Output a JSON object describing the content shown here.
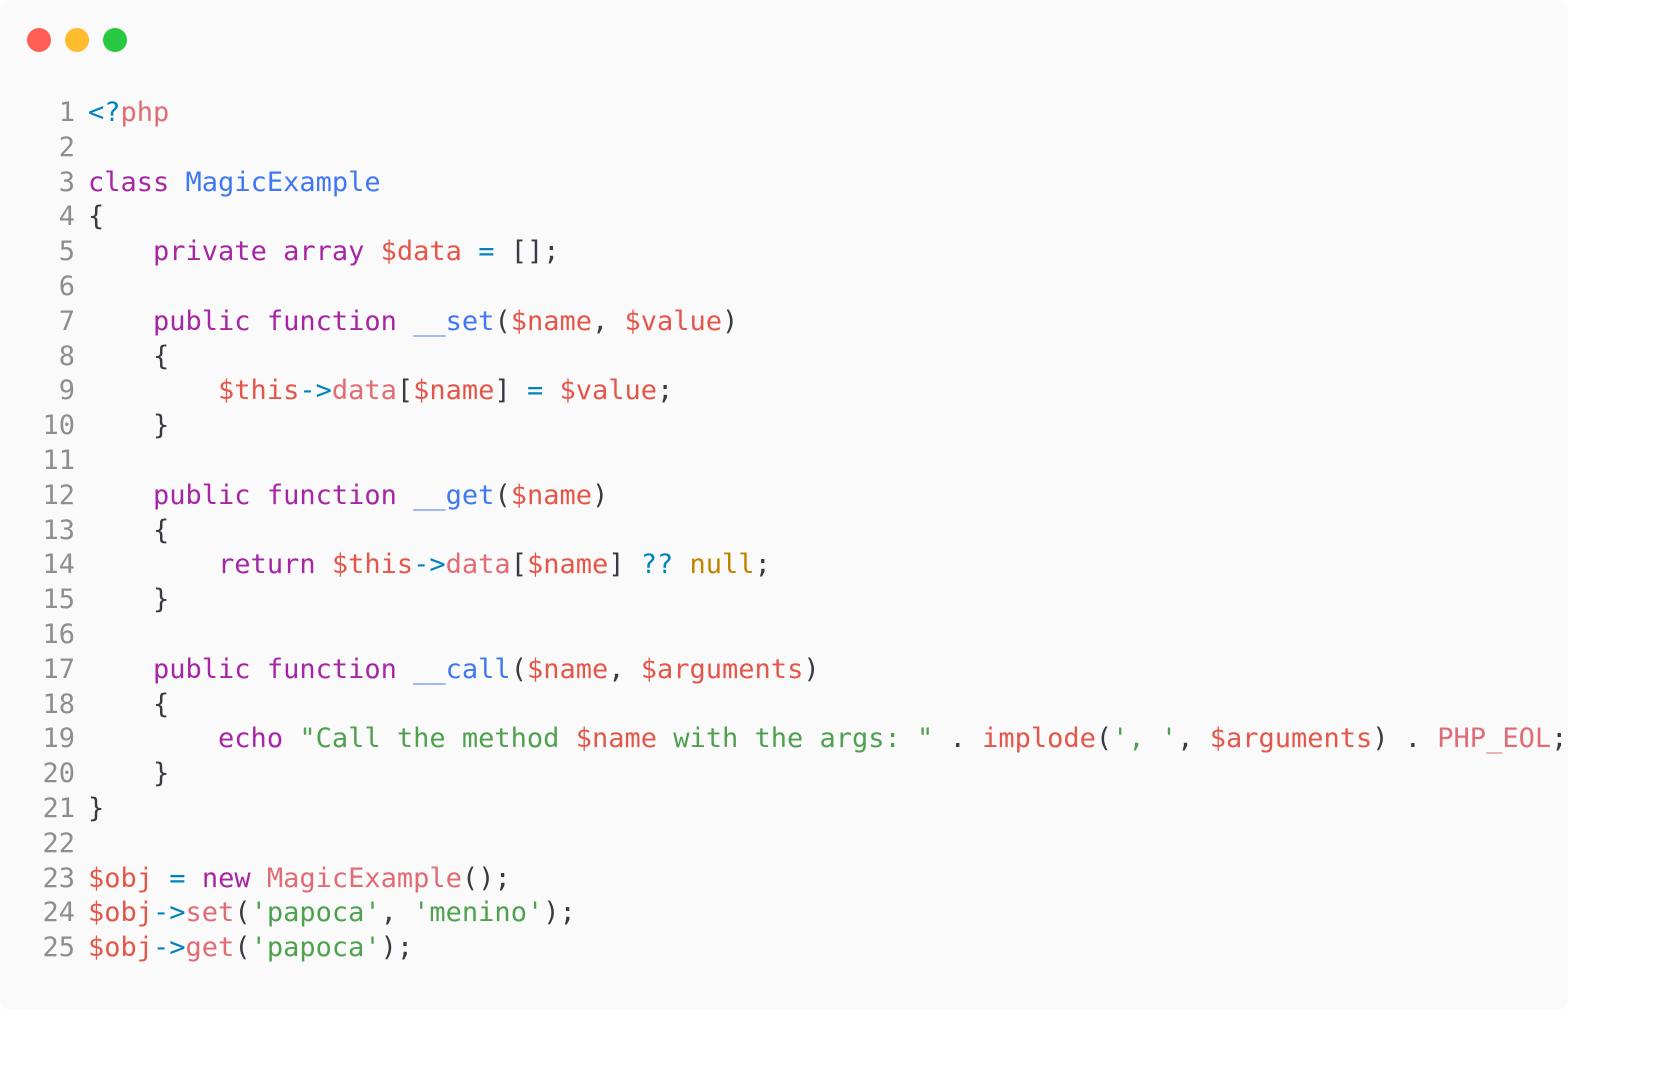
{
  "window": {
    "controls": [
      {
        "name": "close-button",
        "color": "#ff5f57"
      },
      {
        "name": "minimize-button",
        "color": "#febc2e"
      },
      {
        "name": "maximize-button",
        "color": "#28c840"
      }
    ]
  },
  "editor": {
    "language": "php",
    "palette": {
      "plain": "#383a42",
      "keyword": "#a626a4",
      "function": "#4078f2",
      "variable": "#e45649",
      "string": "#50a14f",
      "operator": "#0184bc",
      "constant": "#c18401",
      "tag": "#e06c75",
      "line_number": "#8e8e8e"
    },
    "lines": [
      {
        "n": "1",
        "tokens": [
          {
            "t": "<?",
            "k": "operator"
          },
          {
            "t": "php",
            "k": "tag"
          }
        ]
      },
      {
        "n": "2",
        "tokens": []
      },
      {
        "n": "3",
        "tokens": [
          {
            "t": "class",
            "k": "keyword"
          },
          {
            "t": " ",
            "k": "plain"
          },
          {
            "t": "MagicExample",
            "k": "function"
          }
        ]
      },
      {
        "n": "4",
        "tokens": [
          {
            "t": "{",
            "k": "plain"
          }
        ]
      },
      {
        "n": "5",
        "tokens": [
          {
            "t": "    ",
            "k": "plain"
          },
          {
            "t": "private",
            "k": "keyword"
          },
          {
            "t": " ",
            "k": "plain"
          },
          {
            "t": "array",
            "k": "keyword"
          },
          {
            "t": " ",
            "k": "plain"
          },
          {
            "t": "$data",
            "k": "variable"
          },
          {
            "t": " ",
            "k": "plain"
          },
          {
            "t": "=",
            "k": "operator"
          },
          {
            "t": " [];",
            "k": "plain"
          }
        ]
      },
      {
        "n": "6",
        "tokens": []
      },
      {
        "n": "7",
        "tokens": [
          {
            "t": "    ",
            "k": "plain"
          },
          {
            "t": "public",
            "k": "keyword"
          },
          {
            "t": " ",
            "k": "plain"
          },
          {
            "t": "function",
            "k": "keyword"
          },
          {
            "t": " ",
            "k": "plain"
          },
          {
            "t": "__set",
            "k": "function"
          },
          {
            "t": "(",
            "k": "plain"
          },
          {
            "t": "$name",
            "k": "variable"
          },
          {
            "t": ", ",
            "k": "plain"
          },
          {
            "t": "$value",
            "k": "variable"
          },
          {
            "t": ")",
            "k": "plain"
          }
        ]
      },
      {
        "n": "8",
        "tokens": [
          {
            "t": "    {",
            "k": "plain"
          }
        ]
      },
      {
        "n": "9",
        "tokens": [
          {
            "t": "        ",
            "k": "plain"
          },
          {
            "t": "$this",
            "k": "variable"
          },
          {
            "t": "->",
            "k": "operator"
          },
          {
            "t": "data",
            "k": "tag"
          },
          {
            "t": "[",
            "k": "plain"
          },
          {
            "t": "$name",
            "k": "variable"
          },
          {
            "t": "] ",
            "k": "plain"
          },
          {
            "t": "=",
            "k": "operator"
          },
          {
            "t": " ",
            "k": "plain"
          },
          {
            "t": "$value",
            "k": "variable"
          },
          {
            "t": ";",
            "k": "plain"
          }
        ]
      },
      {
        "n": "10",
        "tokens": [
          {
            "t": "    }",
            "k": "plain"
          }
        ]
      },
      {
        "n": "11",
        "tokens": []
      },
      {
        "n": "12",
        "tokens": [
          {
            "t": "    ",
            "k": "plain"
          },
          {
            "t": "public",
            "k": "keyword"
          },
          {
            "t": " ",
            "k": "plain"
          },
          {
            "t": "function",
            "k": "keyword"
          },
          {
            "t": " ",
            "k": "plain"
          },
          {
            "t": "__get",
            "k": "function"
          },
          {
            "t": "(",
            "k": "plain"
          },
          {
            "t": "$name",
            "k": "variable"
          },
          {
            "t": ")",
            "k": "plain"
          }
        ]
      },
      {
        "n": "13",
        "tokens": [
          {
            "t": "    {",
            "k": "plain"
          }
        ]
      },
      {
        "n": "14",
        "tokens": [
          {
            "t": "        ",
            "k": "plain"
          },
          {
            "t": "return",
            "k": "keyword"
          },
          {
            "t": " ",
            "k": "plain"
          },
          {
            "t": "$this",
            "k": "variable"
          },
          {
            "t": "->",
            "k": "operator"
          },
          {
            "t": "data",
            "k": "tag"
          },
          {
            "t": "[",
            "k": "plain"
          },
          {
            "t": "$name",
            "k": "variable"
          },
          {
            "t": "] ",
            "k": "plain"
          },
          {
            "t": "??",
            "k": "operator"
          },
          {
            "t": " ",
            "k": "plain"
          },
          {
            "t": "null",
            "k": "constant"
          },
          {
            "t": ";",
            "k": "plain"
          }
        ]
      },
      {
        "n": "15",
        "tokens": [
          {
            "t": "    }",
            "k": "plain"
          }
        ]
      },
      {
        "n": "16",
        "tokens": []
      },
      {
        "n": "17",
        "tokens": [
          {
            "t": "    ",
            "k": "plain"
          },
          {
            "t": "public",
            "k": "keyword"
          },
          {
            "t": " ",
            "k": "plain"
          },
          {
            "t": "function",
            "k": "keyword"
          },
          {
            "t": " ",
            "k": "plain"
          },
          {
            "t": "__call",
            "k": "function"
          },
          {
            "t": "(",
            "k": "plain"
          },
          {
            "t": "$name",
            "k": "variable"
          },
          {
            "t": ", ",
            "k": "plain"
          },
          {
            "t": "$arguments",
            "k": "variable"
          },
          {
            "t": ")",
            "k": "plain"
          }
        ]
      },
      {
        "n": "18",
        "tokens": [
          {
            "t": "    {",
            "k": "plain"
          }
        ]
      },
      {
        "n": "19",
        "tokens": [
          {
            "t": "        ",
            "k": "plain"
          },
          {
            "t": "echo",
            "k": "keyword"
          },
          {
            "t": " ",
            "k": "plain"
          },
          {
            "t": "\"Call the method ",
            "k": "string"
          },
          {
            "t": "$name",
            "k": "variable"
          },
          {
            "t": " with the args: \"",
            "k": "string"
          },
          {
            "t": " . ",
            "k": "plain"
          },
          {
            "t": "implode",
            "k": "variable"
          },
          {
            "t": "(",
            "k": "plain"
          },
          {
            "t": "', '",
            "k": "string"
          },
          {
            "t": ", ",
            "k": "plain"
          },
          {
            "t": "$arguments",
            "k": "variable"
          },
          {
            "t": ") . ",
            "k": "plain"
          },
          {
            "t": "PHP_EOL",
            "k": "tag"
          },
          {
            "t": ";",
            "k": "plain"
          }
        ]
      },
      {
        "n": "20",
        "tokens": [
          {
            "t": "    }",
            "k": "plain"
          }
        ]
      },
      {
        "n": "21",
        "tokens": [
          {
            "t": "}",
            "k": "plain"
          }
        ]
      },
      {
        "n": "22",
        "tokens": []
      },
      {
        "n": "23",
        "tokens": [
          {
            "t": "$obj",
            "k": "variable"
          },
          {
            "t": " ",
            "k": "plain"
          },
          {
            "t": "=",
            "k": "operator"
          },
          {
            "t": " ",
            "k": "plain"
          },
          {
            "t": "new",
            "k": "keyword"
          },
          {
            "t": " ",
            "k": "plain"
          },
          {
            "t": "MagicExample",
            "k": "tag"
          },
          {
            "t": "();",
            "k": "plain"
          }
        ]
      },
      {
        "n": "24",
        "tokens": [
          {
            "t": "$obj",
            "k": "variable"
          },
          {
            "t": "->",
            "k": "operator"
          },
          {
            "t": "set",
            "k": "tag"
          },
          {
            "t": "(",
            "k": "plain"
          },
          {
            "t": "'papoca'",
            "k": "string"
          },
          {
            "t": ", ",
            "k": "plain"
          },
          {
            "t": "'menino'",
            "k": "string"
          },
          {
            "t": ");",
            "k": "plain"
          }
        ]
      },
      {
        "n": "25",
        "tokens": [
          {
            "t": "$obj",
            "k": "variable"
          },
          {
            "t": "->",
            "k": "operator"
          },
          {
            "t": "get",
            "k": "tag"
          },
          {
            "t": "(",
            "k": "plain"
          },
          {
            "t": "'papoca'",
            "k": "string"
          },
          {
            "t": ");",
            "k": "plain"
          }
        ]
      }
    ]
  }
}
